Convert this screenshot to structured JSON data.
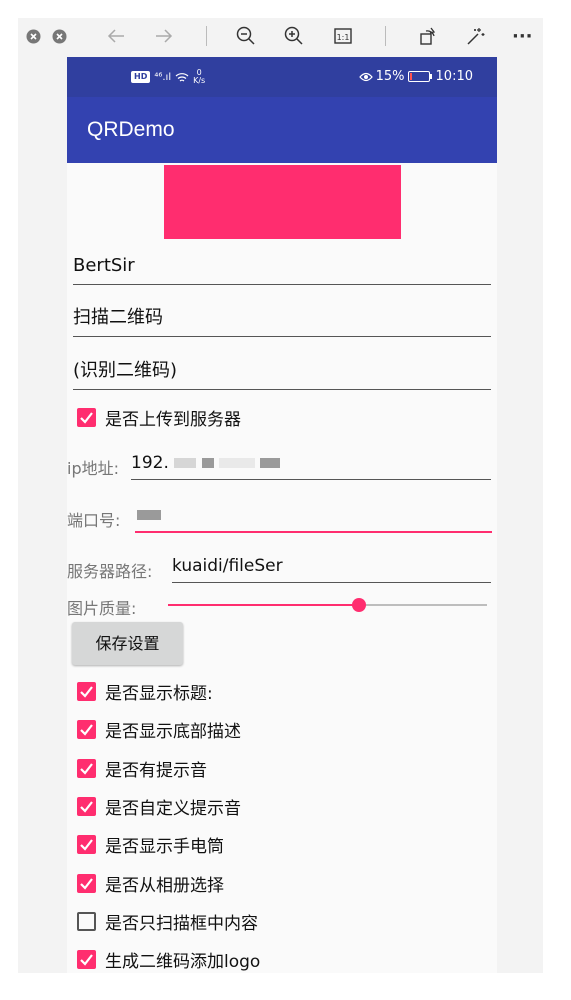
{
  "viewer": {
    "toolbar_icons": [
      "close-window-icon",
      "minimize-window-icon",
      "back-arrow-icon",
      "forward-arrow-icon",
      "zoom-out-icon",
      "zoom-in-icon",
      "actual-size-icon",
      "rotate-icon",
      "magic-wand-icon",
      "more-icon"
    ],
    "more_label": "···"
  },
  "statusbar": {
    "hd": "HD",
    "signal": "⁴⁶.ıl",
    "speed_value": "0",
    "speed_unit": "K/s",
    "battery": "15%",
    "battery_level": 0.15,
    "time": "10:10"
  },
  "appbar": {
    "title": "QRDemo"
  },
  "colors": {
    "primary": "#3342b0",
    "primary_dark": "#303f9f",
    "accent": "#ff2d6f"
  },
  "form": {
    "title_field": "BertSir",
    "scan_field": "扫描二维码",
    "recognize_field": "(识别二维码)",
    "upload_check": {
      "label": "是否上传到服务器",
      "checked": true
    },
    "ip": {
      "label": "ip地址:",
      "value": "192."
    },
    "port": {
      "label": "端口号:"
    },
    "path": {
      "label": "服务器路径:",
      "value": "kuaidi/fileSer"
    },
    "quality": {
      "label": "图片质量:",
      "value": 0.6
    },
    "save_button": "保存设置",
    "options": [
      {
        "label": "是否显示标题:",
        "checked": true
      },
      {
        "label": "是否显示底部描述",
        "checked": true
      },
      {
        "label": "是否有提示音",
        "checked": true
      },
      {
        "label": "是否自定义提示音",
        "checked": true
      },
      {
        "label": "是否显示手电筒",
        "checked": true
      },
      {
        "label": "是否从相册选择",
        "checked": true
      },
      {
        "label": "是否只扫描框中内容",
        "checked": false
      },
      {
        "label": "生成二维码添加logo",
        "checked": true
      }
    ]
  }
}
